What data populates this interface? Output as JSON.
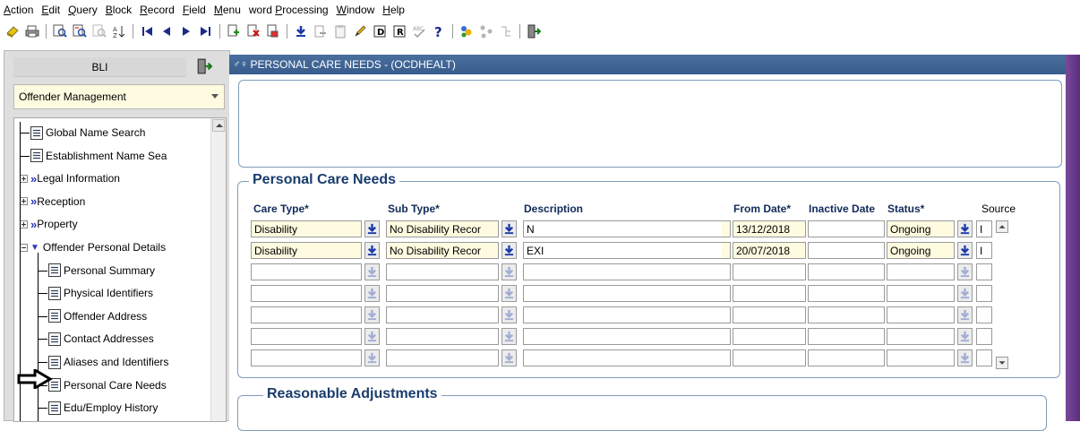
{
  "menu": [
    {
      "label": "Action",
      "u": "A"
    },
    {
      "label": "Edit",
      "u": "E"
    },
    {
      "label": "Query",
      "u": "Q"
    },
    {
      "label": "Block",
      "u": "B"
    },
    {
      "label": "Record",
      "u": "R"
    },
    {
      "label": "Field",
      "u": "F"
    },
    {
      "label": "Menu",
      "u": "M"
    },
    {
      "label": "word Processing",
      "u": "P"
    },
    {
      "label": "Window",
      "u": "W"
    },
    {
      "label": "Help",
      "u": "H"
    }
  ],
  "nav": {
    "bli_label": "BLI",
    "module_select": "Offender Management",
    "tree": [
      {
        "label": "Global Name Search",
        "kind": "doc"
      },
      {
        "label": "Establishment Name Sea",
        "kind": "doc"
      },
      {
        "label": "Legal Information",
        "kind": "folder"
      },
      {
        "label": "Reception",
        "kind": "folder"
      },
      {
        "label": "Property",
        "kind": "folder"
      },
      {
        "label": "Offender Personal Details",
        "kind": "open"
      },
      {
        "label": "Personal Summary",
        "kind": "doc"
      },
      {
        "label": "Physical Identifiers",
        "kind": "doc"
      },
      {
        "label": "Offender Address",
        "kind": "doc"
      },
      {
        "label": "Contact Addresses",
        "kind": "doc"
      },
      {
        "label": "Aliases and Identifiers",
        "kind": "doc"
      },
      {
        "label": "Personal Care Needs",
        "kind": "doc"
      },
      {
        "label": "Edu/Employ History",
        "kind": "doc"
      }
    ]
  },
  "form": {
    "title": "PERSONAL CARE NEEDS - (OCDHEALT)",
    "section1": "Personal Care Needs",
    "section2": "Reasonable Adjustments",
    "columns": {
      "care_type": "Care Type*",
      "sub_type": "Sub Type*",
      "description": "Description",
      "from_date": "From Date*",
      "inactive_date": "Inactive Date",
      "status": "Status*",
      "source": "Source"
    },
    "rows": [
      {
        "care_type": "Disability",
        "sub_type": "No Disability Recor",
        "description": "N",
        "from_date": "13/12/2018",
        "inactive_date": "",
        "status": "Ongoing",
        "source": "I"
      },
      {
        "care_type": "Disability",
        "sub_type": "No Disability Recor",
        "description": "EXI",
        "from_date": "20/07/2018",
        "inactive_date": "",
        "status": "Ongoing",
        "source": "I"
      },
      {
        "care_type": "",
        "sub_type": "",
        "description": "",
        "from_date": "",
        "inactive_date": "",
        "status": "",
        "source": ""
      },
      {
        "care_type": "",
        "sub_type": "",
        "description": "",
        "from_date": "",
        "inactive_date": "",
        "status": "",
        "source": ""
      },
      {
        "care_type": "",
        "sub_type": "",
        "description": "",
        "from_date": "",
        "inactive_date": "",
        "status": "",
        "source": ""
      },
      {
        "care_type": "",
        "sub_type": "",
        "description": "",
        "from_date": "",
        "inactive_date": "",
        "status": "",
        "source": ""
      },
      {
        "care_type": "",
        "sub_type": "",
        "description": "",
        "from_date": "",
        "inactive_date": "",
        "status": "",
        "source": ""
      }
    ]
  },
  "colors": {
    "titlebar": "#375c8c",
    "mandatory_field": "#fffbe0",
    "section_heading": "#1a3c6c",
    "accent_purple": "#5a2d7e"
  }
}
